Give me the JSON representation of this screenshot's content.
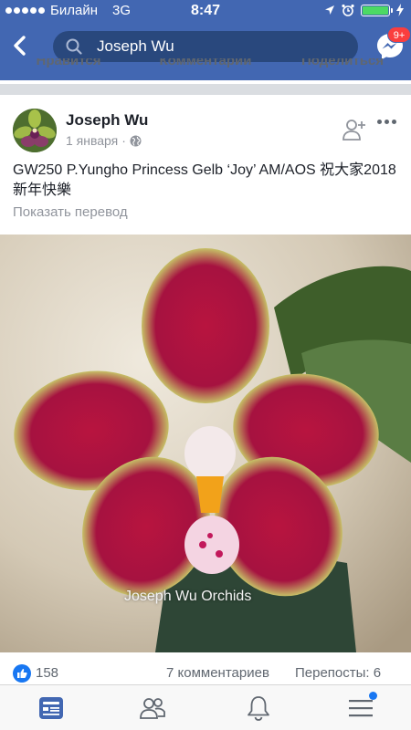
{
  "status_bar": {
    "carrier": "Билайн",
    "network": "3G",
    "time": "8:47"
  },
  "header": {
    "search_query": "Joseph Wu",
    "messenger_badge": "9+"
  },
  "previous_post_actions": [
    "Нравится",
    "Комментарий",
    "Поделиться"
  ],
  "post": {
    "author": "Joseph Wu",
    "date": "1 января",
    "separator": "·",
    "text": "GW250 P.Yungho  Princess  Gelb ‘Joy’ AM/AOS 祝大家2018新年快樂",
    "translate_link": "Показать перевод",
    "photo_watermark": "Joseph Wu Orchids"
  },
  "reactions": {
    "likes": "158",
    "comments": "7 комментариев",
    "shares": "Перепосты: 6"
  },
  "tabs": [
    "news-feed",
    "friends",
    "notifications",
    "menu"
  ],
  "colors": {
    "brand_blue": "#4267b2",
    "search_bg": "#29487d",
    "badge_red": "#fa3e3e",
    "like_blue": "#1877f2",
    "active_tab": "#4267b2",
    "battery_green": "#4cd964"
  }
}
